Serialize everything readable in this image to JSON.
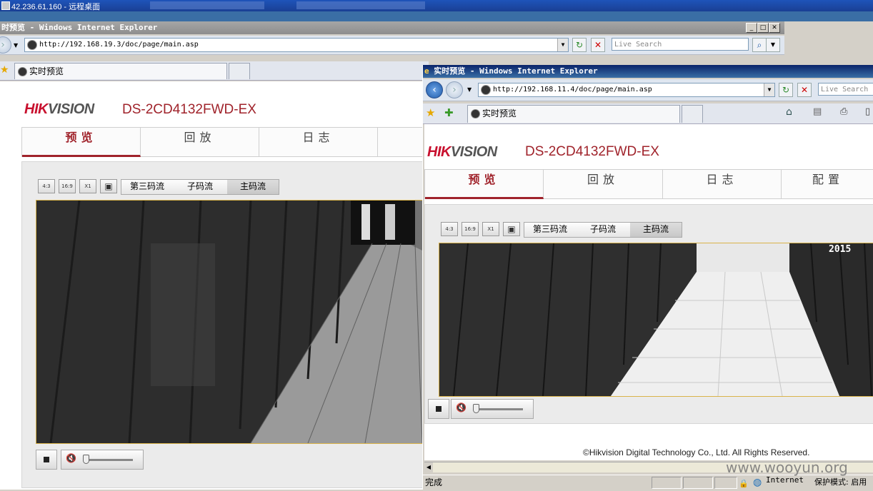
{
  "remote_desktop": {
    "title": "42.236.61.160 - 远程桌面"
  },
  "back_window": {
    "title": "时预览 - Windows Internet Explorer",
    "url": "http://192.168.19.3/doc/page/main.asp",
    "search_placeholder": "Live Search",
    "tab_label": "实时预览",
    "brand_a": "HIK",
    "brand_b": "VISION",
    "model": "DS-2CD4132FWD-EX",
    "menu": [
      "预览",
      "回放",
      "日志"
    ],
    "aspect_buttons": [
      "4:3",
      "16:9",
      "X1"
    ],
    "streams": [
      "第三码流",
      "子码流",
      "主码流"
    ]
  },
  "front_window": {
    "title": "实时预览 - Windows Internet Explorer",
    "url": "http://192.168.11.4/doc/page/main.asp",
    "search_placeholder": "Live Search",
    "tab_label": "实时预览",
    "brand_a": "HIK",
    "brand_b": "VISION",
    "model": "DS-2CD4132FWD-EX",
    "menu": [
      "预览",
      "回放",
      "日志",
      "配置"
    ],
    "aspect_buttons": [
      "4:3",
      "16:9",
      "X1"
    ],
    "streams": [
      "第三码流",
      "子码流",
      "主码流"
    ],
    "osd_text": "2015",
    "copyright": "©Hikvision Digital Technology Co., Ltd. All Rights Reserved.",
    "status": {
      "left": "完成",
      "zone": "Internet",
      "protected_mode": "保护模式: 启用"
    }
  },
  "watermark": "www.wooyun.org",
  "icons": [
    "back-arrow-icon",
    "forward-arrow-icon",
    "refresh-icon",
    "stop-icon",
    "search-icon",
    "favorites-star-icon",
    "add-favorites-icon",
    "home-icon",
    "feeds-icon",
    "print-icon",
    "page-icon",
    "stop-video-icon",
    "mute-speaker-icon",
    "globe-icon",
    "lock-icon"
  ],
  "colors": {
    "brand_red": "#c8102e",
    "model_red": "#a0232b",
    "title_active": "#0a246a",
    "video_border": "#d9b34a"
  }
}
